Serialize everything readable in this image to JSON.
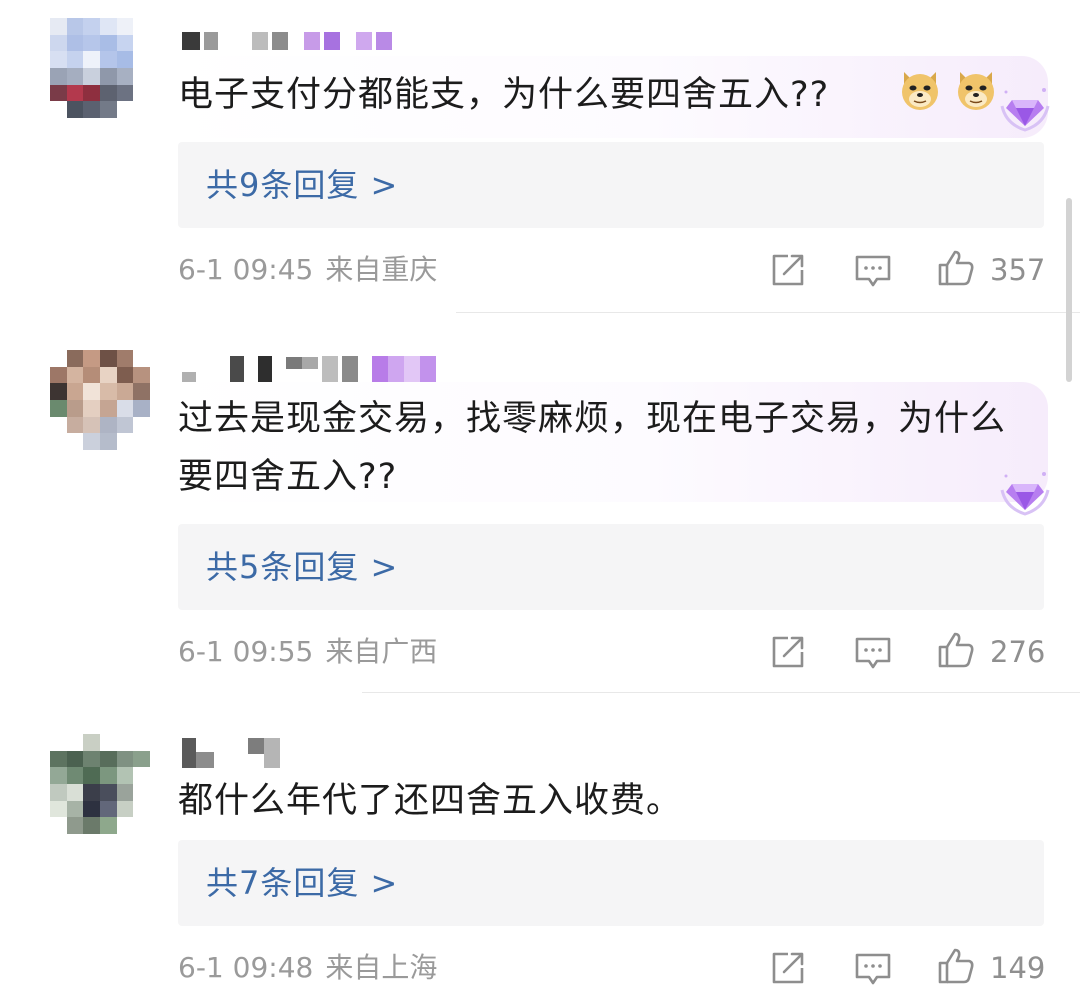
{
  "comments": [
    {
      "text": "电子支付分都能支，为什么要四舍五入??",
      "reply_label": "共9条回复 >",
      "time": "6-1 09:45",
      "location": "来自重庆",
      "likes": "357",
      "emojis": [
        "doge-emoji",
        "doge-emoji"
      ]
    },
    {
      "text": "过去是现金交易，找零麻烦，现在电子交易，为什么要四舍五入??",
      "reply_label": "共5条回复 >",
      "time": "6-1 09:55",
      "location": "来自广西",
      "likes": "276"
    },
    {
      "text": "都什么年代了还四舍五入收费。",
      "reply_label": "共7条回复 >",
      "time": "6-1 09:48",
      "location": "来自上海",
      "likes": "149"
    }
  ],
  "icons": {
    "repost": "share-square-icon",
    "comment": "comment-icon",
    "like": "thumbs-up-icon",
    "badge": "purple-diamond-badge-icon"
  },
  "colors": {
    "reply_link": "#3c6aa6",
    "meta_text": "#9a9a9a",
    "reply_bg": "#f5f5f6",
    "bubble_tint": "#f6ecfb"
  }
}
